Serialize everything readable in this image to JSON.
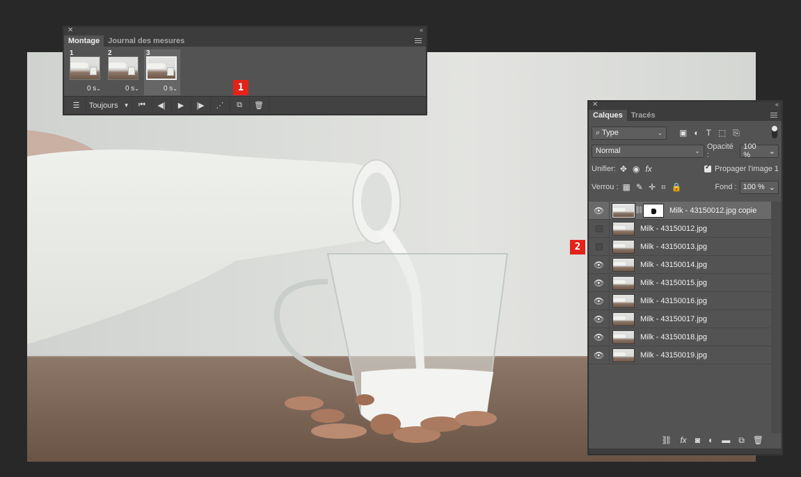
{
  "montage_panel": {
    "tabs": [
      "Montage",
      "Journal des mesures"
    ],
    "frames": [
      {
        "number": "1",
        "delay": "0 s"
      },
      {
        "number": "2",
        "delay": "0 s"
      },
      {
        "number": "3",
        "delay": "0 s"
      }
    ],
    "loop_option": "Toujours",
    "badge": "1"
  },
  "layers_panel": {
    "tabs": [
      "Calques",
      "Tracés"
    ],
    "filter_kind": "Type",
    "blend_mode": "Normal",
    "opacity_label": "Opacité :",
    "opacity_value": "100 %",
    "unify_label": "Unifier:",
    "propagate_label": "Propager l'image 1",
    "lock_label": "Verrou :",
    "fill_label": "Fond :",
    "fill_value": "100 %",
    "layers": [
      {
        "name": "Milk - 43150012.jpg copie",
        "visible": true,
        "selected": true,
        "has_mask": true
      },
      {
        "name": "Milk - 43150012.jpg",
        "visible": false
      },
      {
        "name": "Milk - 43150013.jpg",
        "visible": false
      },
      {
        "name": "Milk - 43150014.jpg",
        "visible": true
      },
      {
        "name": "Milk - 43150015.jpg",
        "visible": true
      },
      {
        "name": "Milk - 43150016.jpg",
        "visible": true
      },
      {
        "name": "Milk - 43150017.jpg",
        "visible": true
      },
      {
        "name": "Milk - 43150018.jpg",
        "visible": true
      },
      {
        "name": "Milk - 43150019.jpg",
        "visible": true
      }
    ],
    "badge": "2"
  },
  "icons": {
    "close": "close-icon",
    "collapse": "collapse-icon",
    "panel_menu": "panel-menu-icon",
    "eye": "eye-icon"
  },
  "colors": {
    "badge": "#e2231a",
    "panel_bg": "#535353",
    "app_bg": "#282828"
  }
}
